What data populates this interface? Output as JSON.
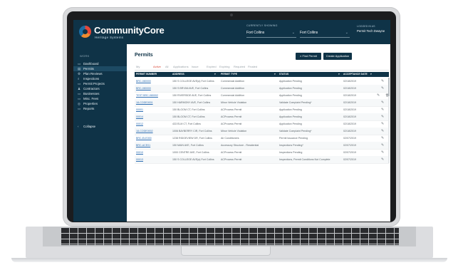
{
  "brand": {
    "name": "CommunityCore",
    "subtitle": "Heritage Systems"
  },
  "header": {
    "showing_label": "CURRENTLY SHOWING",
    "jurisdiction": "Fort Collins",
    "location": "Fort Collins",
    "logged_label": "LOGGED IN AS",
    "user": "Permit Tech Dwayne"
  },
  "sidebar": {
    "heading": "WORK",
    "items": [
      {
        "label": "Dashboard",
        "icon": "dashboard-icon",
        "glyph": "▭"
      },
      {
        "label": "Permits",
        "icon": "permit-icon",
        "glyph": "▤"
      },
      {
        "label": "Plan Reviews",
        "icon": "review-icon",
        "glyph": "⚙"
      },
      {
        "label": "Inspections",
        "icon": "inspection-icon",
        "glyph": "⌕"
      },
      {
        "label": "Permit Projects",
        "icon": "project-icon",
        "glyph": "▭"
      },
      {
        "label": "Contractors",
        "icon": "contractor-icon",
        "glyph": "♟"
      },
      {
        "label": "Businesses",
        "icon": "business-icon",
        "glyph": "▭"
      },
      {
        "label": "Misc. Fees",
        "icon": "fee-icon",
        "glyph": "▭"
      },
      {
        "label": "Properties",
        "icon": "property-icon",
        "glyph": "◎"
      },
      {
        "label": "Reports",
        "icon": "report-icon",
        "glyph": "▭"
      }
    ],
    "collapse": "Collapse"
  },
  "main": {
    "title": "Permits",
    "find_button": "Find Permit",
    "create_button": "Create Application",
    "tabs": [
      "My Work",
      "Active",
      "All",
      "Applications",
      "Issue Due",
      "Expired",
      "Expiring",
      "Required",
      "Finaled"
    ],
    "active_tab": 1,
    "columns": [
      "PERMIT NUMBER",
      "ADDRESS",
      "PERMIT TYPE",
      "STATUS",
      "ACCEPTANCE DATE"
    ],
    "rows": [
      [
        "BRC-080000",
        "150 S COLLEGE AVE(a) Fort Collins",
        "Commercial Addition",
        "Application Pending",
        "02/18/2019"
      ],
      [
        "BRC-080000",
        "150 S BRYAN AVE, Fort Collins",
        "Commercial Addition",
        "Application Pending",
        "02/18/2019"
      ],
      [
        "TEST BRC-080002",
        "150 RIVERSIDE AVE, Fort Collins",
        "Commercial Addition",
        "Application Pending",
        "02/18/2019"
      ],
      [
        "18-CODE0001",
        "150 HARMONY AVE, Fort Collins",
        "Minor Vehicle Violation",
        "Validate Complaint Pending*",
        "02/18/2019"
      ],
      [
        "00001",
        "150 BLOOM CT, Fort Collins",
        "ACProcess Permit",
        "Application Pending",
        "02/18/2019"
      ],
      [
        "00014",
        "150 BLOOM CT, Fort Collins",
        "ACProcess Permit",
        "Application Pending",
        "02/18/2019"
      ],
      [
        "00012",
        "433 ELM CT, Fort Collins",
        "ACProcess Permit",
        "Application Pending",
        "02/18/2019"
      ],
      [
        "18-CODE0002",
        "1006 BAYBERRY CIR, Fort Collins",
        "Minor Vehicle Violation",
        "Validate Complaint Pending*",
        "02/18/2019"
      ],
      [
        "BRC-ELE000",
        "1238 RIDGEVIEW DR, Fort Collins",
        "Air Conditioners",
        "Permit Issuance Pending",
        "02/07/2019"
      ],
      [
        "BRC-ACE01",
        "150 MAIN AVE, Fort Collins",
        "Accessory Structure - Residential",
        "Inspections Pending*",
        "02/07/2019"
      ],
      [
        "00010",
        "1000 CENTRE AVE, Fort Collins",
        "ACProcess Permit",
        "Inspections Pending",
        "02/07/2019"
      ],
      [
        "00013",
        "150 S COLLEGE AVE(a) Fort Collins",
        "ACProcess Permit",
        "Inspections, Permit Conditions Not Complete",
        "02/07/2019"
      ]
    ]
  }
}
